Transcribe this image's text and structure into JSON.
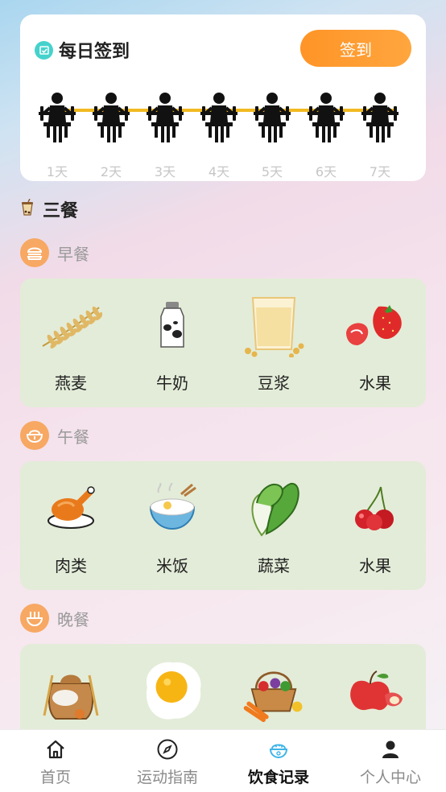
{
  "signin_card": {
    "title": "每日签到",
    "button_label": "签到",
    "days": [
      "1天",
      "2天",
      "3天",
      "4天",
      "5天",
      "6天",
      "7天"
    ],
    "track_color": "#f2ba22"
  },
  "meals_section": {
    "title": "三餐",
    "meals": [
      {
        "name": "早餐",
        "icon": "burger-icon",
        "foods": [
          {
            "name": "燕麦",
            "icon": "oat-icon"
          },
          {
            "name": "牛奶",
            "icon": "milk-icon"
          },
          {
            "name": "豆浆",
            "icon": "soymilk-icon"
          },
          {
            "name": "水果",
            "icon": "strawberry-icon"
          }
        ]
      },
      {
        "name": "午餐",
        "icon": "rice-bowl-icon",
        "foods": [
          {
            "name": "肉类",
            "icon": "roast-chicken-icon"
          },
          {
            "name": "米饭",
            "icon": "rice-icon"
          },
          {
            "name": "蔬菜",
            "icon": "cabbage-icon"
          },
          {
            "name": "水果",
            "icon": "cherry-icon"
          }
        ]
      },
      {
        "name": "晚餐",
        "icon": "noodle-bowl-icon",
        "foods": [
          {
            "name": "",
            "icon": "grain-sack-icon"
          },
          {
            "name": "",
            "icon": "fried-egg-icon"
          },
          {
            "name": "",
            "icon": "vegetable-basket-icon"
          },
          {
            "name": "",
            "icon": "apple-icon"
          }
        ]
      }
    ]
  },
  "bottom_nav": {
    "items": [
      {
        "label": "首页",
        "icon": "home-icon"
      },
      {
        "label": "运动指南",
        "icon": "compass-icon"
      },
      {
        "label": "饮食记录",
        "icon": "rice-bowl-icon"
      },
      {
        "label": "个人中心",
        "icon": "person-icon"
      }
    ],
    "active": "饮食记录",
    "accent_color": "#3fb4e8"
  }
}
